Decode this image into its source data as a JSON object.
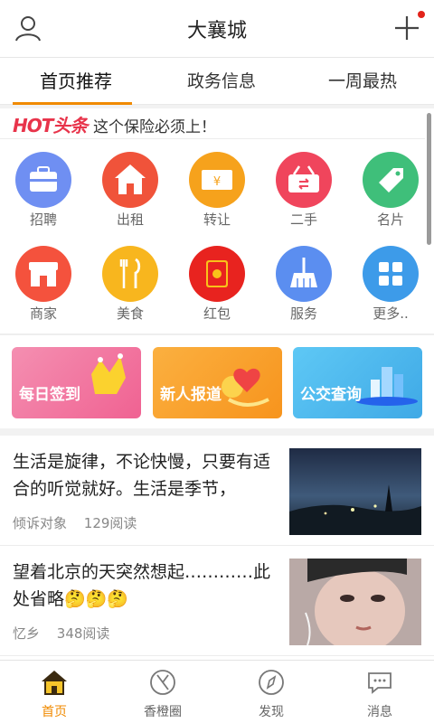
{
  "header": {
    "title": "大襄城",
    "user_icon": "user-icon",
    "plus_icon": "plus-icon",
    "notification_color": "#e2231a"
  },
  "tabs": [
    {
      "label": "首页推荐",
      "active": true
    },
    {
      "label": "政务信息",
      "active": false
    },
    {
      "label": "一周最热",
      "active": false
    }
  ],
  "accent_color": "#f08a00",
  "hot": {
    "logo": "HOT头条",
    "text": "这个保险必须上！"
  },
  "grid": [
    {
      "label": "招聘",
      "icon": "briefcase-icon",
      "color": "#6f8ff2"
    },
    {
      "label": "出租",
      "icon": "house-icon",
      "color": "#f0533a"
    },
    {
      "label": "转让",
      "icon": "ticket-icon",
      "color": "#f6a21c"
    },
    {
      "label": "二手",
      "icon": "basket-icon",
      "color": "#f0455c"
    },
    {
      "label": "名片",
      "icon": "tag-icon",
      "color": "#3fbf7a"
    },
    {
      "label": "商家",
      "icon": "shop-icon",
      "color": "#f4523d"
    },
    {
      "label": "美食",
      "icon": "fork-knife-icon",
      "color": "#f8b61e"
    },
    {
      "label": "红包",
      "icon": "red-packet-icon",
      "color": "#e8231f"
    },
    {
      "label": "服务",
      "icon": "broom-icon",
      "color": "#5b8ef0"
    },
    {
      "label": "更多..",
      "icon": "more-grid-icon",
      "color": "#3d9be9"
    }
  ],
  "banners": [
    {
      "label": "每日签到",
      "icon": "crown-icon",
      "color": "#f57aa0"
    },
    {
      "label": "新人报道",
      "icon": "heart-icon",
      "color": "#f7a52b"
    },
    {
      "label": "公交查询",
      "icon": "city-icon",
      "color": "#4cb6ee"
    }
  ],
  "articles": [
    {
      "title": "生活是旋律，不论快慢，只要有适合的听觉就好。生活是季节，",
      "author": "倾诉对象",
      "reads": "129阅读",
      "thumb": "night-sky-photo"
    },
    {
      "title": "望着北京的天突然想起…………此处省略",
      "emoji": "🤔🤔🤔",
      "author": "忆乡",
      "reads": "348阅读",
      "thumb": "face-photo"
    }
  ],
  "bottom_nav": [
    {
      "label": "首页",
      "icon": "home-icon",
      "active": true
    },
    {
      "label": "香橙圈",
      "icon": "orange-circle-icon",
      "active": false
    },
    {
      "label": "发现",
      "icon": "compass-icon",
      "active": false
    },
    {
      "label": "消息",
      "icon": "message-icon",
      "active": false
    }
  ]
}
